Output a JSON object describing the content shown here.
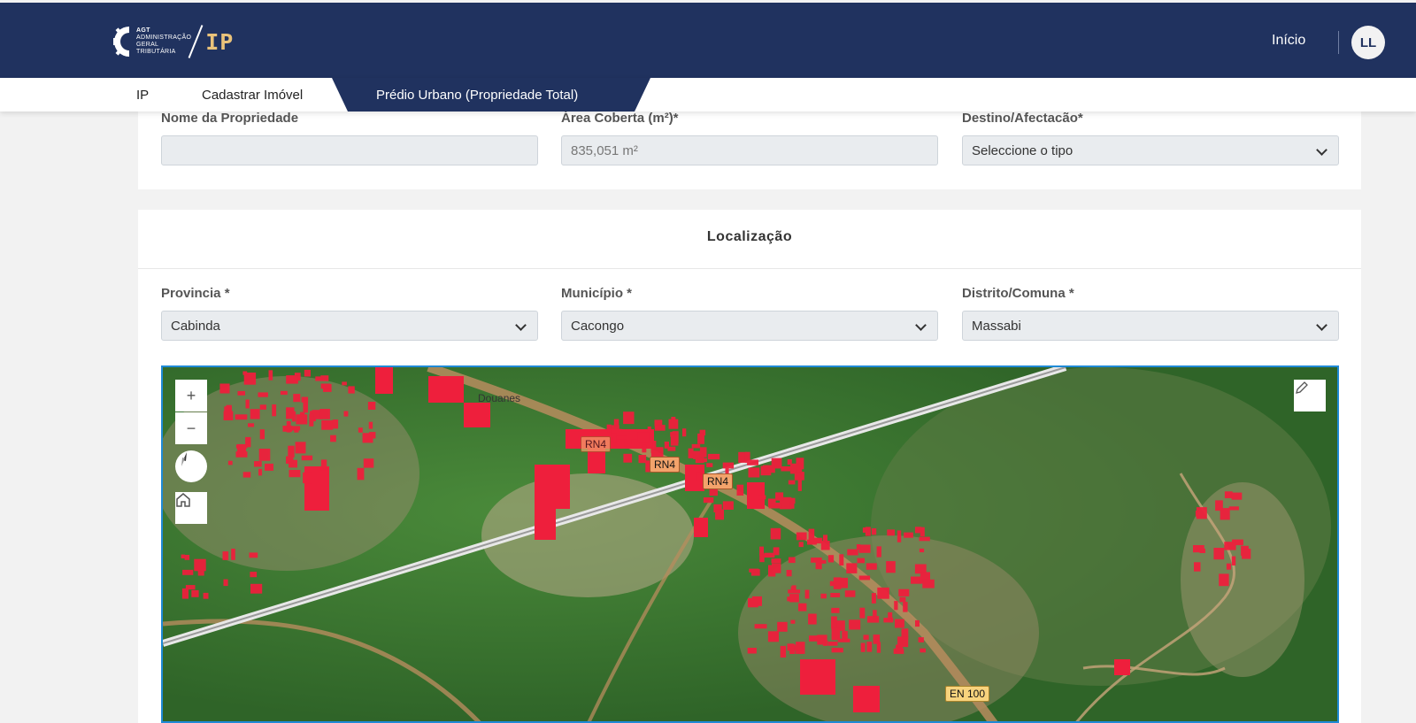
{
  "header": {
    "logo": {
      "line1": "AGT",
      "line2": "ADMINISTRAÇÃO",
      "line3": "GERAL",
      "line4": "TRIBUTÁRIA",
      "app": "IP"
    },
    "nav_home": "Início",
    "avatar_initials": "LL"
  },
  "breadcrumb": {
    "items": [
      "IP",
      "Cadastrar Imóvel",
      "Prédio Urbano (Propriedade Total)"
    ]
  },
  "property": {
    "name_label": "Nome da Propriedade",
    "name_value": "",
    "area_label": "Área Coberta (m²)*",
    "area_value": "835,051 m²",
    "destino_label": "Destino/Afectacão*",
    "destino_value": "Seleccione o tipo"
  },
  "location": {
    "title": "Localização",
    "provincia_label": "Provincia *",
    "provincia_value": "Cabinda",
    "municipio_label": "Município *",
    "municipio_value": "Cacongo",
    "distrito_label": "Distrito/Comuna *",
    "distrito_value": "Massabi"
  },
  "map": {
    "zoom_in": "+",
    "zoom_out": "−",
    "labels": {
      "place": "Douanes"
    },
    "shields": [
      "RN4",
      "RN4",
      "RN4",
      "EN 100"
    ],
    "colors": {
      "buildings": "#ee1f3c",
      "vegetation": "#3f7d33",
      "roads": "#b78c5e"
    }
  }
}
